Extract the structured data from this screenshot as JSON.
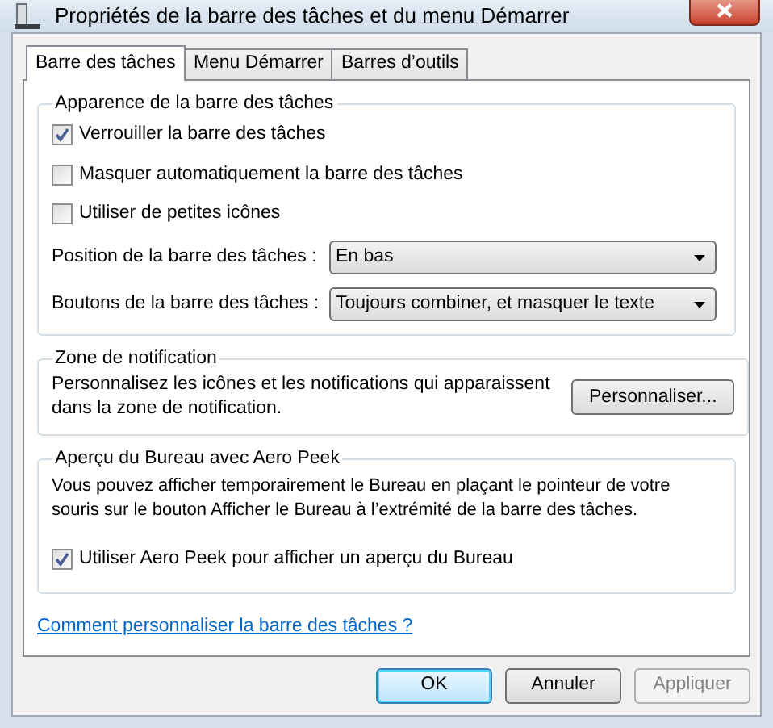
{
  "window": {
    "title": "Propriétés de la barre des tâches et du menu Démarrer"
  },
  "tabs": [
    {
      "label": "Barre des tâches",
      "selected": true
    },
    {
      "label": "Menu Démarrer",
      "selected": false
    },
    {
      "label": "Barres d’outils",
      "selected": false
    }
  ],
  "appearance": {
    "title": "Apparence de la barre des tâches",
    "checkboxes": [
      {
        "label": "Verrouiller la barre des tâches",
        "checked": true
      },
      {
        "label": "Masquer automatiquement la barre des tâches",
        "checked": false
      },
      {
        "label": "Utiliser de petites icônes",
        "checked": false
      }
    ],
    "dropdowns": [
      {
        "label": "Position de la barre des tâches :",
        "value": "En bas"
      },
      {
        "label": "Boutons de la barre des tâches :",
        "value": "Toujours combiner, et masquer le texte"
      }
    ]
  },
  "notification": {
    "title": "Zone de notification",
    "text": "Personnalisez les icônes et les notifications qui apparaissent dans la zone de notification.",
    "button": "Personnaliser..."
  },
  "aero_peek": {
    "title": "Aperçu du Bureau avec Aero Peek",
    "text": "Vous pouvez afficher temporairement le Bureau en plaçant le pointeur de votre souris sur le bouton Afficher le Bureau à l’extrémité de la barre des tâches.",
    "checkbox": {
      "label": "Utiliser Aero Peek pour afficher un aperçu du Bureau",
      "checked": true
    }
  },
  "help_link": "Comment personnaliser la barre des tâches ?",
  "buttons": [
    {
      "label": "OK",
      "default": true,
      "disabled": false
    },
    {
      "label": "Annuler",
      "default": false,
      "disabled": false
    },
    {
      "label": "Appliquer",
      "default": false,
      "disabled": true
    }
  ]
}
